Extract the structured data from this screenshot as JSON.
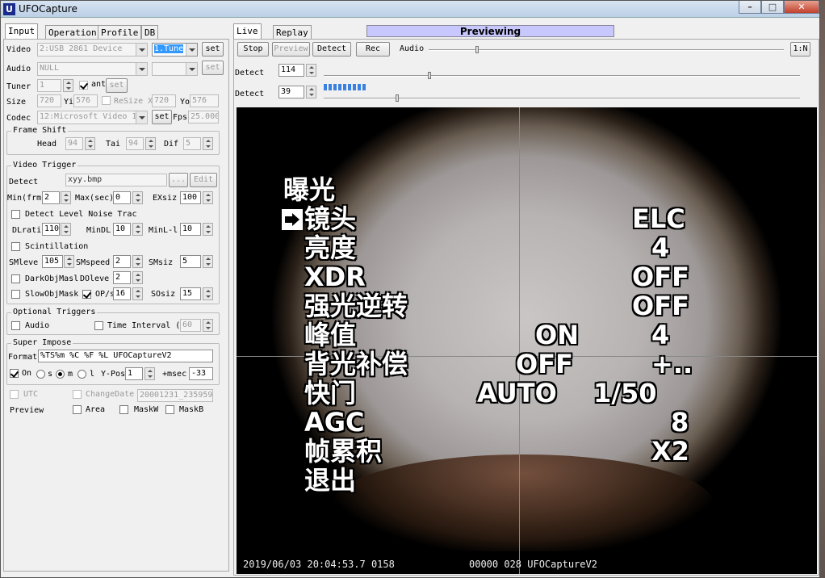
{
  "window": {
    "title": "UFOCapture",
    "icon_letter": "U"
  },
  "left_tabs": [
    "Input",
    "Operation",
    "Profile",
    "DB"
  ],
  "input": {
    "video_label": "Video",
    "video_device": "2:USB 2861 Device",
    "video_tuner": "1.Tune",
    "set_label": "set",
    "audio_label": "Audio",
    "audio_device": "NULL",
    "tuner_label": "Tuner",
    "tuner_value": "1",
    "ant_label": "ant",
    "size_label": "Size",
    "size_x": "720",
    "size_yi_label": "Yi",
    "size_y": "576",
    "resize_label": "ReSize X",
    "resize_x": "720",
    "resize_y_label": "Yo",
    "resize_y": "576",
    "codec_label": "Codec",
    "codec_value": "12:Microsoft Video 1",
    "fps_label": "Fps",
    "fps_value": "25.000"
  },
  "frame_shift": {
    "title": "Frame Shift",
    "head_label": "Head",
    "head_value": "94",
    "tail_label": "Tai",
    "tail_value": "94",
    "dif_label": "Dif",
    "dif_value": "5"
  },
  "video_trigger": {
    "title": "Video Trigger",
    "detect_label": "Detect",
    "detect_file": "xyy.bmp",
    "browse_label": "...",
    "edit_label": "Edit",
    "min_label": "Min(frm",
    "min_value": "2",
    "max_label": "Max(sec)",
    "max_value": "0",
    "exsize_label": "EXsiz",
    "exsize_value": "100",
    "detect_level_label": "Detect Level Noise Trac",
    "dlratio_label": "DLrati",
    "dlratio_value": "110",
    "mindl_label": "MinDL",
    "mindl_value": "10",
    "minl_label": "MinL-l",
    "minl_value": "10",
    "scint_label": "Scintillation",
    "smlevel_label": "SMleve",
    "smlevel_value": "105",
    "smspeed_label": "SMspeed",
    "smspeed_value": "2",
    "smsize_label": "SMsiz",
    "smsize_value": "5",
    "darkobj_label": "DarkObjMasl",
    "dolevel_label": "DOleve",
    "dolevel_value": "2",
    "slowobj_label": "SlowObjMask",
    "ops_label": "OP/s",
    "ops_value": "16",
    "sosize_label": "SOsiz",
    "sosize_value": "15"
  },
  "optional_triggers": {
    "title": "Optional Triggers",
    "audio_label": "Audio",
    "time_interval_label": "Time Interval (",
    "time_interval_value": "60"
  },
  "super_impose": {
    "title": "Super Impose",
    "format_label": "Format",
    "format_value": "%TS%m %C %F %L UFOCaptureV2",
    "on_label": "On",
    "s_label": "s",
    "m_label": "m",
    "l_label": "l",
    "ypos_label": "Y-Pos",
    "ypos_value": "1",
    "msec_label": "+msec",
    "msec_value": "-33",
    "utc_label": "UTC",
    "changedate_label": "ChangeDate",
    "changedate_value": "20001231_235959"
  },
  "preview": {
    "label": "Preview",
    "area_label": "Area",
    "maskw_label": "MaskW",
    "maskb_label": "MaskB"
  },
  "right_tabs": [
    "Live",
    "Replay"
  ],
  "status": "Previewing",
  "toolbar": {
    "stop": "Stop",
    "preview": "Preview",
    "detect": "Detect",
    "rec": "Rec",
    "audio_label": "Audio",
    "ratio_btn": "1:N"
  },
  "detect_rows": [
    {
      "label": "Detect",
      "value": "114"
    },
    {
      "label": "Detect",
      "value": "39"
    }
  ],
  "osd": {
    "title": "曝光",
    "rows": [
      {
        "label": "镜头",
        "mid": "",
        "value": "ELC"
      },
      {
        "label": "亮度",
        "mid": "",
        "value": "4"
      },
      {
        "label": "XDR",
        "mid": "",
        "value": "OFF"
      },
      {
        "label": "强光逆转",
        "mid": "",
        "value": "OFF"
      },
      {
        "label": "峰值",
        "mid": "ON",
        "value": "4"
      },
      {
        "label": "背光补偿",
        "mid": "OFF",
        "value": "+.."
      },
      {
        "label": "快门",
        "mid": "AUTO",
        "value": "1/50"
      },
      {
        "label": "AGC",
        "mid": "",
        "value": "8"
      },
      {
        "label": "帧累积",
        "mid": "",
        "value": "X2"
      },
      {
        "label": "退出",
        "mid": "",
        "value": ""
      }
    ]
  },
  "timestamp_left": "2019/06/03 20:04:53.7 0158",
  "timestamp_right": "00000 028 UFOCaptureV2"
}
